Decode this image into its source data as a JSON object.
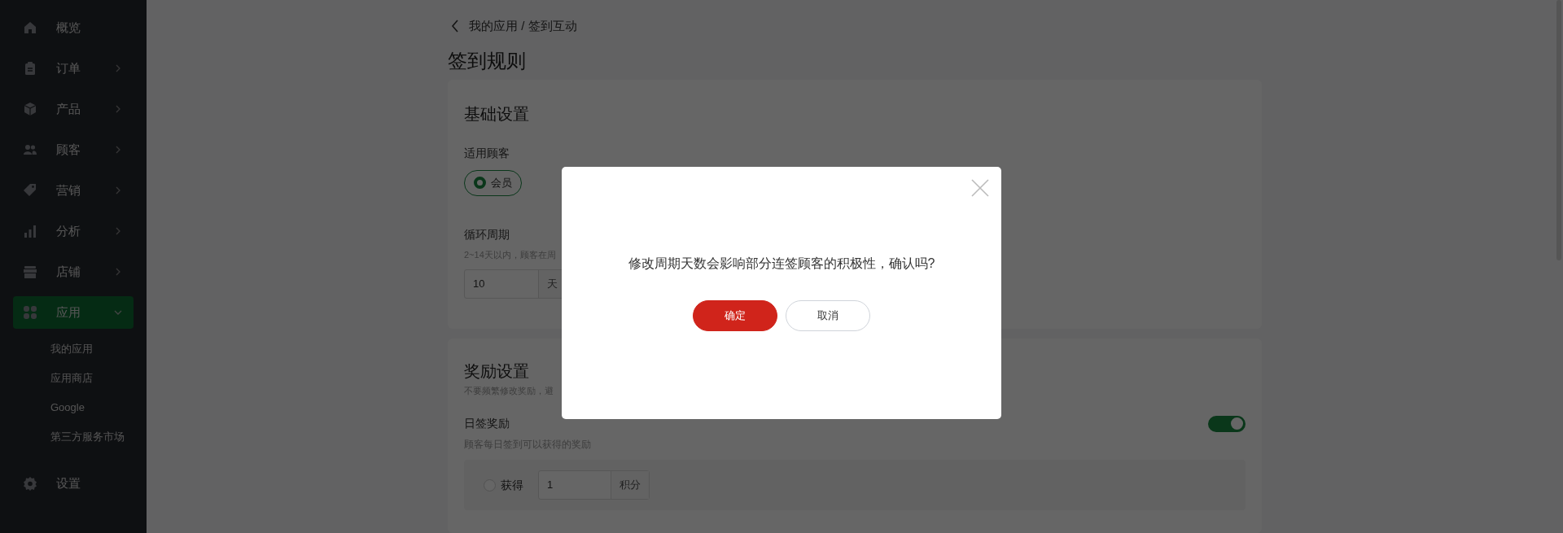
{
  "sidebar": {
    "items": [
      {
        "label": "概览",
        "kind": "link",
        "selected": false
      },
      {
        "label": "订单",
        "kind": "group",
        "expanded": false,
        "selected": false
      },
      {
        "label": "产品",
        "kind": "group",
        "expanded": false,
        "selected": false
      },
      {
        "label": "顾客",
        "kind": "group",
        "expanded": false,
        "selected": false
      },
      {
        "label": "营销",
        "kind": "group",
        "expanded": false,
        "selected": false
      },
      {
        "label": "分析",
        "kind": "group",
        "expanded": false,
        "selected": false
      },
      {
        "label": "店铺",
        "kind": "group",
        "expanded": false,
        "selected": false
      },
      {
        "label": "应用",
        "kind": "group",
        "expanded": true,
        "selected": true,
        "children": [
          {
            "label": "我的应用"
          },
          {
            "label": "应用商店"
          },
          {
            "label": "Google"
          },
          {
            "label": "第三方服务市场"
          }
        ]
      },
      {
        "label": "设置",
        "kind": "link",
        "selected": false
      }
    ]
  },
  "breadcrumb": "我的应用 / 签到互动",
  "page_title": "签到规则",
  "basic_settings": {
    "title": "基础设置",
    "audience_label": "适用顾客",
    "audience_options": [
      {
        "label": "会员",
        "selected": true
      }
    ],
    "cycle_label": "循环周期",
    "cycle_hint": "2~14天以内，顾客在周",
    "cycle_input": {
      "value": "10",
      "suffix": "天"
    }
  },
  "reward_settings": {
    "title": "奖励设置",
    "hint": "不要频繁修改奖励，避",
    "daily": {
      "label": "日签奖励",
      "on": true,
      "hint": "顾客每日签到可以获得的奖励",
      "option": {
        "label": "获得",
        "selected": false,
        "value": "1",
        "suffix": "积分"
      }
    }
  },
  "dialog": {
    "message": "修改周期天数会影响部分连签顾客的积极性，确认吗?",
    "buttons": [
      {
        "label": "确定",
        "kind": "primary"
      },
      {
        "label": "取消",
        "kind": "secondary"
      }
    ]
  }
}
